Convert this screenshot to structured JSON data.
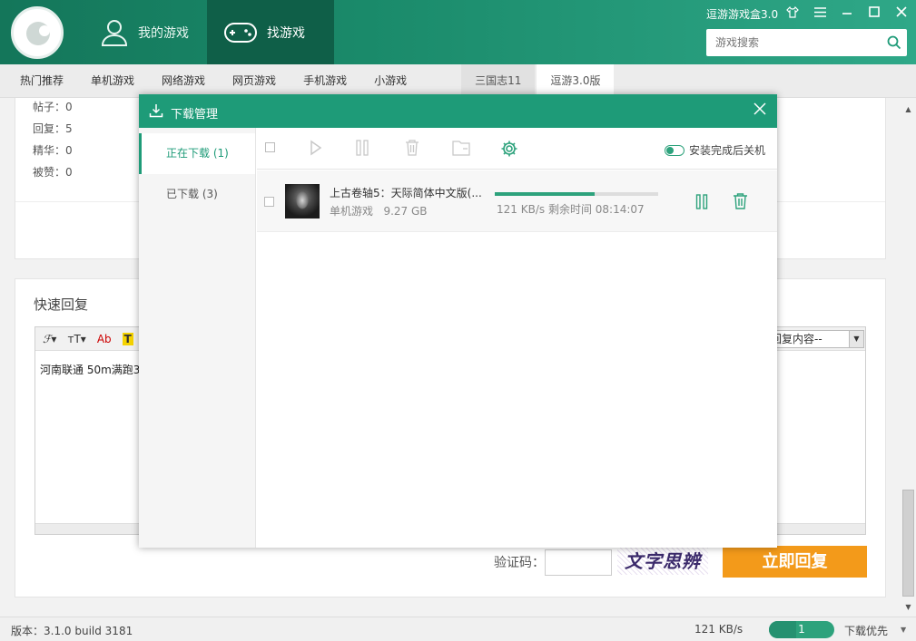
{
  "header": {
    "app_title": "逗游游戏盒3.0",
    "nav": [
      {
        "label": "我的游戏",
        "icon": "user-icon"
      },
      {
        "label": "找游戏",
        "icon": "gamepad-icon"
      }
    ],
    "search": {
      "placeholder": "游戏搜索"
    },
    "window_controls": [
      "skin-icon",
      "menu-icon",
      "minimize-icon",
      "maximize-icon",
      "close-icon"
    ]
  },
  "categories": [
    "热门推荐",
    "单机游戏",
    "网络游戏",
    "网页游戏",
    "手机游戏",
    "小游戏",
    "三国志11",
    "逗游3.0版"
  ],
  "post_stats": {
    "posts": "帖子：0",
    "replies": "回复：5",
    "featured": "精华：0",
    "likes": "被赞：0"
  },
  "reply": {
    "title": "快速回复",
    "text": "河南联通  50m满跑3",
    "quick_select": "捷回复内容--",
    "captcha_label": "验证码：",
    "captcha_text": "文字思辨",
    "submit": "立即回复"
  },
  "download_manager": {
    "title": "下载管理",
    "tabs": [
      {
        "label": "正在下载 (1)",
        "active": true
      },
      {
        "label": "已下载 (3)",
        "active": false
      }
    ],
    "toggle_label": "安装完成后关机",
    "items": [
      {
        "name": "上古卷轴5：天际简体中文版(...",
        "category": "单机游戏",
        "size": "9.27 GB",
        "speed": "121 KB/s",
        "remaining": "剩余时间 08:14:07",
        "progress": 0.61
      }
    ]
  },
  "statusbar": {
    "version": "版本：3.1.0 build 3181",
    "speed": "121 KB/s",
    "download_count": "1",
    "priority": "下载优先"
  },
  "colors": {
    "brand": "#1e9b78",
    "header_dark": "#0f5f48",
    "accent_orange": "#f39a1a"
  }
}
